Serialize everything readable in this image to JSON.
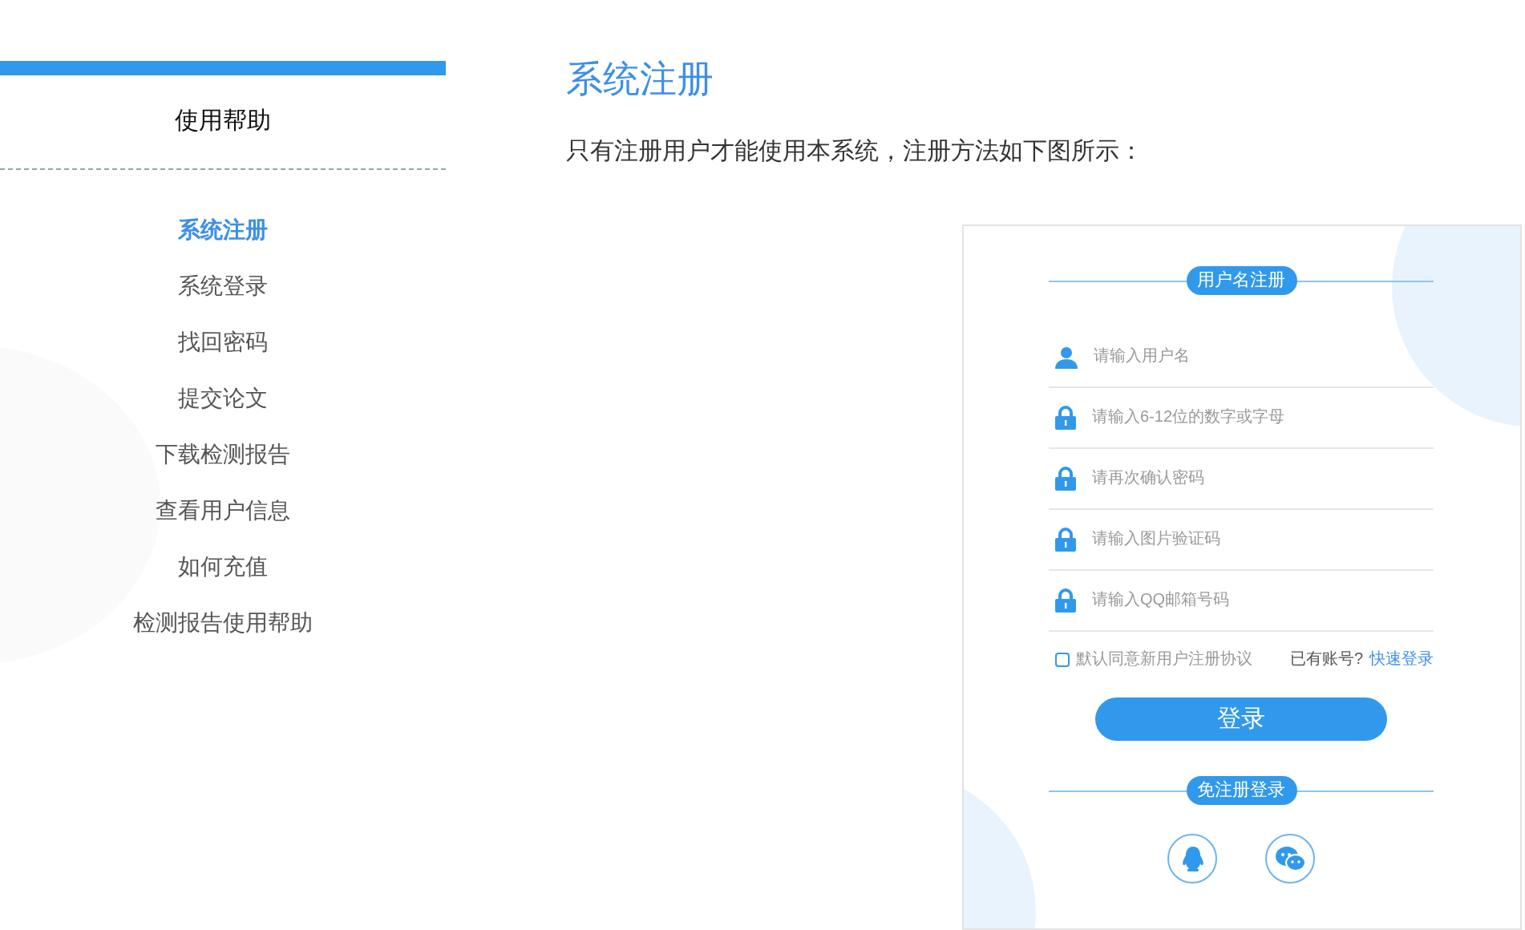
{
  "sidebar": {
    "title": "使用帮助",
    "items": [
      {
        "label": "系统注册",
        "selected": true
      },
      {
        "label": "系统登录",
        "selected": false
      },
      {
        "label": "找回密码",
        "selected": false
      },
      {
        "label": "提交论文",
        "selected": false
      },
      {
        "label": "下载检测报告",
        "selected": false
      },
      {
        "label": "查看用户信息",
        "selected": false
      },
      {
        "label": "如何充值",
        "selected": false
      },
      {
        "label": "检测报告使用帮助",
        "selected": false
      }
    ]
  },
  "article": {
    "title": "系统注册",
    "text": "只有注册用户才能使用本系统，注册方法如下图所示："
  },
  "figure": {
    "section_label": "用户名注册",
    "fields": [
      {
        "kind": "user",
        "placeholder": "请输入用户名"
      },
      {
        "kind": "lock",
        "placeholder": "请输入6-12位的数字或字母"
      },
      {
        "kind": "lock",
        "placeholder": "请再次确认密码"
      },
      {
        "kind": "lock",
        "placeholder": "请输入图片验证码"
      },
      {
        "kind": "lock",
        "placeholder": "请输入QQ邮箱号码"
      }
    ],
    "agreement": {
      "label": "默认同意新用户注册协议",
      "checked": false
    },
    "login_prompt": "已有账号?",
    "login_link": "快速登录",
    "submit": "登录",
    "alt_label": "免注册登录",
    "social": [
      {
        "kind": "qq"
      },
      {
        "kind": "wechat"
      }
    ]
  }
}
